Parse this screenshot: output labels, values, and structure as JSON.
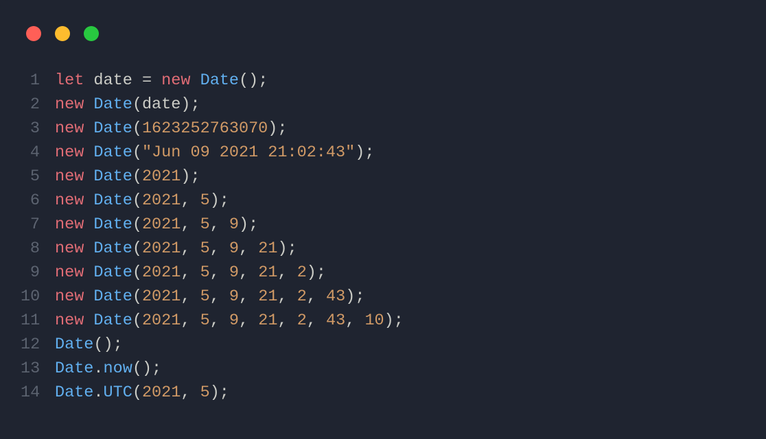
{
  "traffic_lights": {
    "red": "#ff5f57",
    "yellow": "#febc2e",
    "green": "#28c840"
  },
  "lines": [
    {
      "n": "1",
      "tokens": [
        [
          "let",
          "kw"
        ],
        [
          " ",
          "sp"
        ],
        [
          "date",
          "id"
        ],
        [
          " ",
          "sp"
        ],
        [
          "=",
          "op"
        ],
        [
          " ",
          "sp"
        ],
        [
          "new",
          "kw"
        ],
        [
          " ",
          "sp"
        ],
        [
          "Date",
          "cls"
        ],
        [
          "();",
          "punct"
        ]
      ]
    },
    {
      "n": "2",
      "tokens": [
        [
          "new",
          "kw"
        ],
        [
          " ",
          "sp"
        ],
        [
          "Date",
          "cls"
        ],
        [
          "(",
          "punct"
        ],
        [
          "date",
          "id"
        ],
        [
          ");",
          "punct"
        ]
      ]
    },
    {
      "n": "3",
      "tokens": [
        [
          "new",
          "kw"
        ],
        [
          " ",
          "sp"
        ],
        [
          "Date",
          "cls"
        ],
        [
          "(",
          "punct"
        ],
        [
          "1623252763070",
          "num"
        ],
        [
          ");",
          "punct"
        ]
      ]
    },
    {
      "n": "4",
      "tokens": [
        [
          "new",
          "kw"
        ],
        [
          " ",
          "sp"
        ],
        [
          "Date",
          "cls"
        ],
        [
          "(",
          "punct"
        ],
        [
          "\"Jun 09 2021 21:02:43\"",
          "str"
        ],
        [
          ");",
          "punct"
        ]
      ]
    },
    {
      "n": "5",
      "tokens": [
        [
          "new",
          "kw"
        ],
        [
          " ",
          "sp"
        ],
        [
          "Date",
          "cls"
        ],
        [
          "(",
          "punct"
        ],
        [
          "2021",
          "num"
        ],
        [
          ");",
          "punct"
        ]
      ]
    },
    {
      "n": "6",
      "tokens": [
        [
          "new",
          "kw"
        ],
        [
          " ",
          "sp"
        ],
        [
          "Date",
          "cls"
        ],
        [
          "(",
          "punct"
        ],
        [
          "2021",
          "num"
        ],
        [
          ", ",
          "punct"
        ],
        [
          "5",
          "num"
        ],
        [
          ");",
          "punct"
        ]
      ]
    },
    {
      "n": "7",
      "tokens": [
        [
          "new",
          "kw"
        ],
        [
          " ",
          "sp"
        ],
        [
          "Date",
          "cls"
        ],
        [
          "(",
          "punct"
        ],
        [
          "2021",
          "num"
        ],
        [
          ", ",
          "punct"
        ],
        [
          "5",
          "num"
        ],
        [
          ", ",
          "punct"
        ],
        [
          "9",
          "num"
        ],
        [
          ");",
          "punct"
        ]
      ]
    },
    {
      "n": "8",
      "tokens": [
        [
          "new",
          "kw"
        ],
        [
          " ",
          "sp"
        ],
        [
          "Date",
          "cls"
        ],
        [
          "(",
          "punct"
        ],
        [
          "2021",
          "num"
        ],
        [
          ", ",
          "punct"
        ],
        [
          "5",
          "num"
        ],
        [
          ", ",
          "punct"
        ],
        [
          "9",
          "num"
        ],
        [
          ", ",
          "punct"
        ],
        [
          "21",
          "num"
        ],
        [
          ");",
          "punct"
        ]
      ]
    },
    {
      "n": "9",
      "tokens": [
        [
          "new",
          "kw"
        ],
        [
          " ",
          "sp"
        ],
        [
          "Date",
          "cls"
        ],
        [
          "(",
          "punct"
        ],
        [
          "2021",
          "num"
        ],
        [
          ", ",
          "punct"
        ],
        [
          "5",
          "num"
        ],
        [
          ", ",
          "punct"
        ],
        [
          "9",
          "num"
        ],
        [
          ", ",
          "punct"
        ],
        [
          "21",
          "num"
        ],
        [
          ", ",
          "punct"
        ],
        [
          "2",
          "num"
        ],
        [
          ");",
          "punct"
        ]
      ]
    },
    {
      "n": "10",
      "tokens": [
        [
          "new",
          "kw"
        ],
        [
          " ",
          "sp"
        ],
        [
          "Date",
          "cls"
        ],
        [
          "(",
          "punct"
        ],
        [
          "2021",
          "num"
        ],
        [
          ", ",
          "punct"
        ],
        [
          "5",
          "num"
        ],
        [
          ", ",
          "punct"
        ],
        [
          "9",
          "num"
        ],
        [
          ", ",
          "punct"
        ],
        [
          "21",
          "num"
        ],
        [
          ", ",
          "punct"
        ],
        [
          "2",
          "num"
        ],
        [
          ", ",
          "punct"
        ],
        [
          "43",
          "num"
        ],
        [
          ");",
          "punct"
        ]
      ]
    },
    {
      "n": "11",
      "tokens": [
        [
          "new",
          "kw"
        ],
        [
          " ",
          "sp"
        ],
        [
          "Date",
          "cls"
        ],
        [
          "(",
          "punct"
        ],
        [
          "2021",
          "num"
        ],
        [
          ", ",
          "punct"
        ],
        [
          "5",
          "num"
        ],
        [
          ", ",
          "punct"
        ],
        [
          "9",
          "num"
        ],
        [
          ", ",
          "punct"
        ],
        [
          "21",
          "num"
        ],
        [
          ", ",
          "punct"
        ],
        [
          "2",
          "num"
        ],
        [
          ", ",
          "punct"
        ],
        [
          "43",
          "num"
        ],
        [
          ", ",
          "punct"
        ],
        [
          "10",
          "num"
        ],
        [
          ");",
          "punct"
        ]
      ]
    },
    {
      "n": "12",
      "tokens": [
        [
          "Date",
          "cls"
        ],
        [
          "();",
          "punct"
        ]
      ]
    },
    {
      "n": "13",
      "tokens": [
        [
          "Date",
          "cls"
        ],
        [
          ".",
          "punct"
        ],
        [
          "now",
          "fn"
        ],
        [
          "();",
          "punct"
        ]
      ]
    },
    {
      "n": "14",
      "tokens": [
        [
          "Date",
          "cls"
        ],
        [
          ".",
          "punct"
        ],
        [
          "UTC",
          "fn"
        ],
        [
          "(",
          "punct"
        ],
        [
          "2021",
          "num"
        ],
        [
          ", ",
          "punct"
        ],
        [
          "5",
          "num"
        ],
        [
          ");",
          "punct"
        ]
      ]
    }
  ]
}
